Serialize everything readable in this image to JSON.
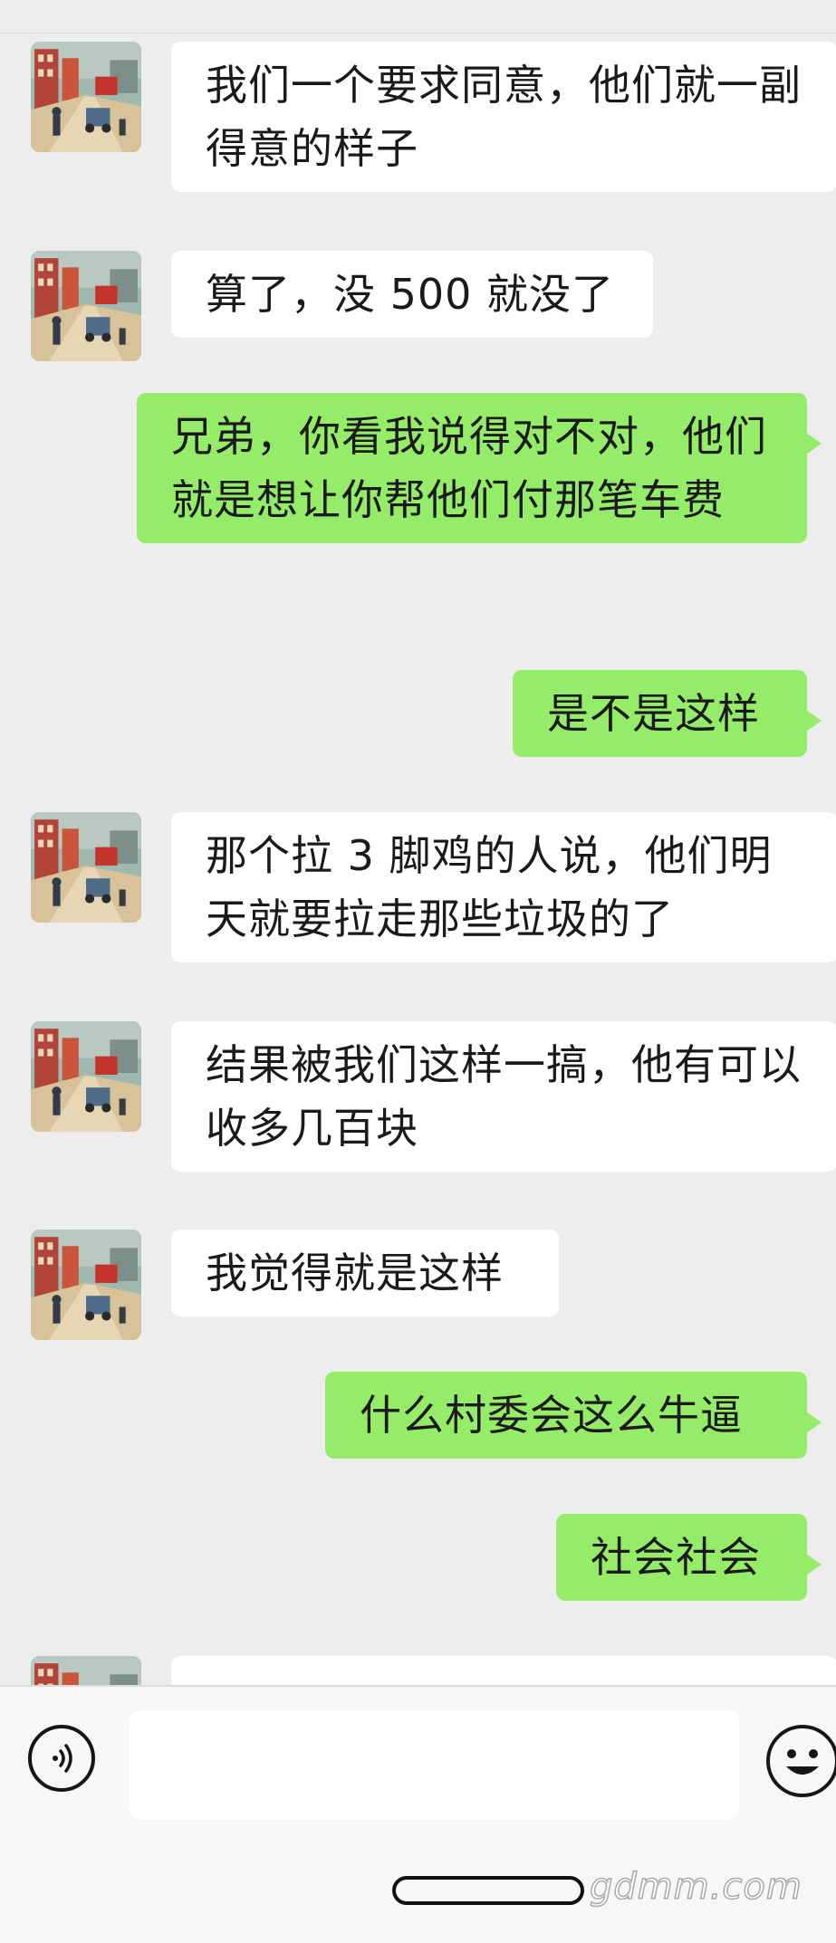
{
  "messages": [
    {
      "side": "in",
      "text": "我们一个要求同意，他们就一副得意的样子"
    },
    {
      "side": "in",
      "text": "算了，没 500 就没了"
    },
    {
      "side": "out",
      "text": "兄弟，你看我说得对不对，他们就是想让你帮他们付那笔车费"
    },
    {
      "side": "out",
      "text": "是不是这样"
    },
    {
      "side": "in",
      "text": "那个拉 3 脚鸡的人说，他们明天就要拉走那些垃圾的了"
    },
    {
      "side": "in",
      "text": "结果被我们这样一搞，他有可以收多几百块"
    },
    {
      "side": "in",
      "text": "我觉得就是这样"
    },
    {
      "side": "out",
      "text": "什么村委会这么牛逼"
    },
    {
      "side": "out",
      "text": "社会社会"
    },
    {
      "side": "in",
      "text": ""
    }
  ],
  "input": {
    "placeholder": "",
    "value": ""
  },
  "icons": {
    "voice": "voice-icon",
    "emoji": "emoji-icon",
    "avatar": "contact-avatar"
  },
  "colors": {
    "background": "#ededed",
    "incoming_bubble": "#ffffff",
    "outgoing_bubble": "#95ec69",
    "text": "#1a1a1a"
  },
  "watermark": "gdmm.com"
}
